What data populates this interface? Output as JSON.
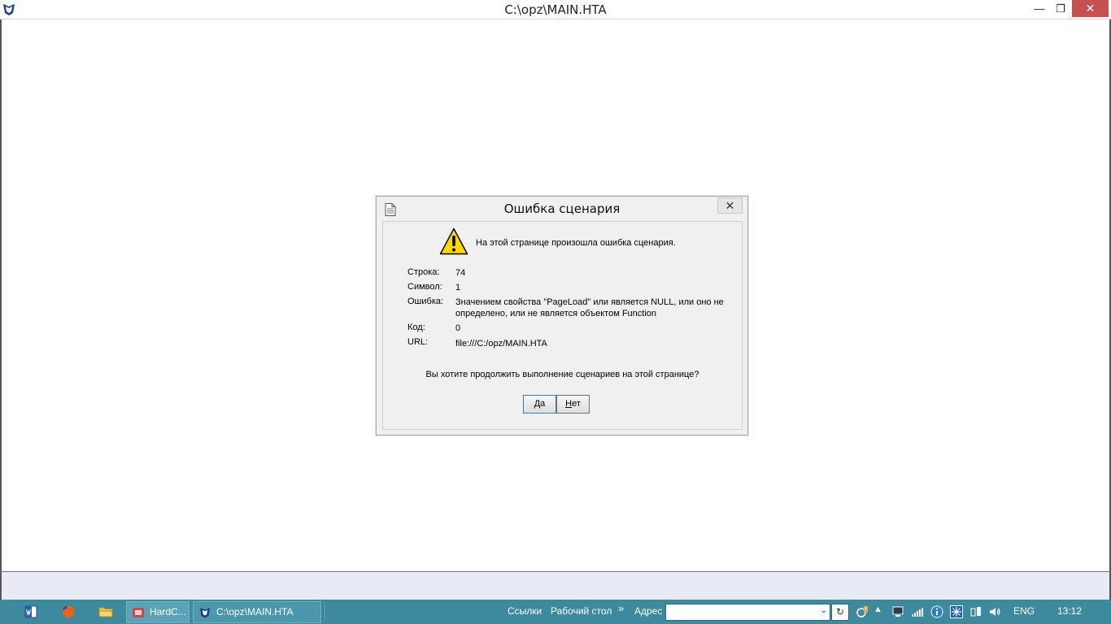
{
  "window": {
    "title": "C:\\opz\\MAIN.HTA",
    "min_glyph": "—",
    "max_glyph": "❐",
    "close_glyph": "✕"
  },
  "dialog": {
    "title": "Ошибка сценария",
    "close_glyph": "✕",
    "message": "На этой странице произошла ошибка сценария.",
    "rows": [
      {
        "label": "Строка:",
        "value": "74"
      },
      {
        "label": "Символ:",
        "value": "1"
      },
      {
        "label": "Ошибка:",
        "value": "Значением свойства \"PageLoad\" или является NULL, или оно не определено, или не является объектом Function"
      },
      {
        "label": "Код:",
        "value": "0"
      },
      {
        "label": "URL:",
        "value": "file:///C:/opz/MAIN.HTA"
      }
    ],
    "question": "Вы хотите продолжить выполнение сценариев на этой странице?",
    "yes_label_u": "Д",
    "yes_label_rest": "а",
    "no_label_u": "Н",
    "no_label_rest": "ет"
  },
  "taskbar": {
    "tasks": [
      {
        "label": "HardC..."
      },
      {
        "label": "C:\\opz\\MAIN.HTA"
      }
    ],
    "links_label": "Ссылки",
    "desktop_label": "Рабочий стол",
    "chevron": "»",
    "address_label": "Адрес",
    "address_value": "",
    "refresh_glyph": "↻",
    "language": "ENG",
    "clock": "13:12"
  },
  "colors": {
    "taskbar": "#3d8a9f",
    "close_button": "#c75050",
    "warning_yellow": "#ffd800"
  }
}
